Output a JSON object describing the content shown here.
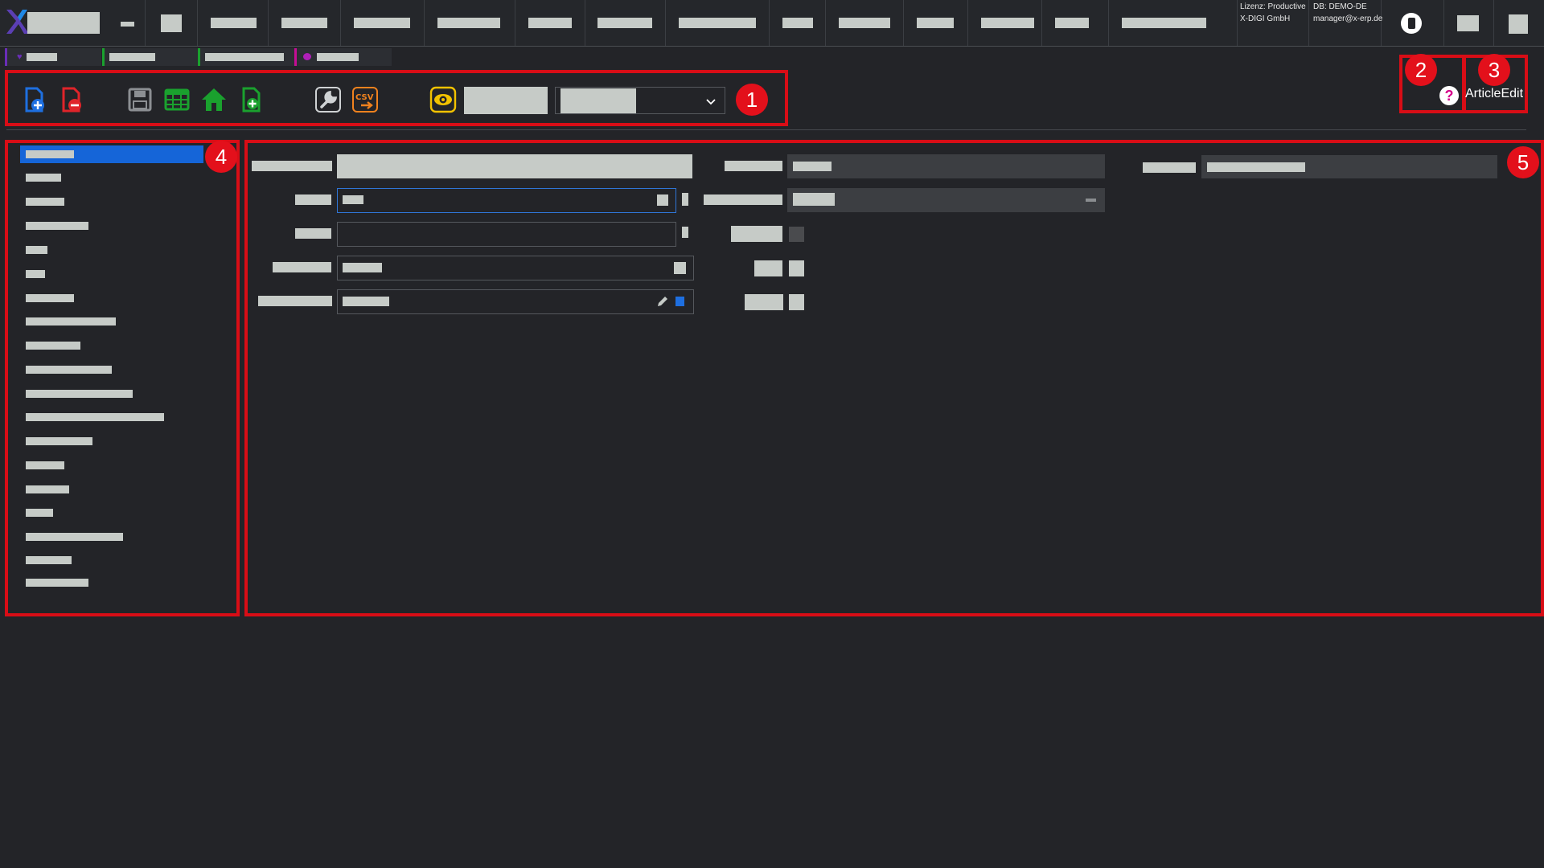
{
  "app": {
    "license_text": "Lizenz: Productive",
    "company": "X-DIGI GmbH",
    "db_text": "DB: DEMO-DE",
    "user": "manager@x-erp.de",
    "logo_letter": "X"
  },
  "toolbar": {
    "icons": [
      "new-record-icon",
      "delete-record-icon",
      "save-icon",
      "table-view-icon",
      "home-icon",
      "add-document-icon",
      "settings-wrench-icon",
      "csv-export-icon",
      "view-eye-icon",
      "chevron-down-icon"
    ]
  },
  "header": {
    "help_icon": "help-icon",
    "help_glyph": "?",
    "form_name": "ArticleEdit"
  },
  "annotations": [
    "1",
    "2",
    "3",
    "4",
    "5"
  ],
  "colors": {
    "background": "#232428",
    "annotation_red": "#d80d16",
    "selection_blue": "#1565d8",
    "icon_blue": "#1e6fe0",
    "icon_red": "#e0242a",
    "icon_green": "#1aa12e",
    "icon_orange": "#f0821e",
    "icon_yellow": "#f2c200"
  }
}
